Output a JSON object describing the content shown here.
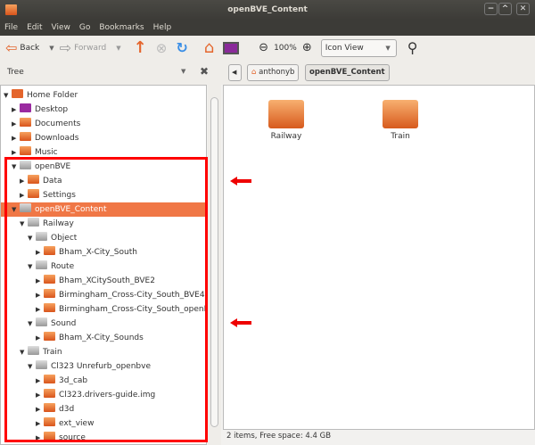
{
  "window": {
    "title": "openBVE_Content"
  },
  "menu": [
    "File",
    "Edit",
    "View",
    "Go",
    "Bookmarks",
    "Help"
  ],
  "toolbar": {
    "back": "Back",
    "forward": "Forward",
    "zoom": "100%",
    "view_mode": "Icon View"
  },
  "sidebar": {
    "label": "Tree"
  },
  "breadcrumb": [
    "anthonyb",
    "openBVE_Content"
  ],
  "tree": [
    {
      "label": "Home Folder",
      "level": 0,
      "expanded": true,
      "icon": "home"
    },
    {
      "label": "Desktop",
      "level": 1,
      "expanded": false,
      "icon": "desktop"
    },
    {
      "label": "Documents",
      "level": 1,
      "expanded": false,
      "icon": "documents"
    },
    {
      "label": "Downloads",
      "level": 1,
      "expanded": false,
      "icon": "downloads"
    },
    {
      "label": "Music",
      "level": 1,
      "expanded": false,
      "icon": "music"
    },
    {
      "label": "openBVE",
      "level": 1,
      "expanded": true,
      "icon": "grey"
    },
    {
      "label": "Data",
      "level": 2,
      "expanded": false,
      "icon": "orange"
    },
    {
      "label": "Settings",
      "level": 2,
      "expanded": false,
      "icon": "orange"
    },
    {
      "label": "openBVE_Content",
      "level": 1,
      "expanded": true,
      "icon": "grey",
      "selected": true
    },
    {
      "label": "Railway",
      "level": 2,
      "expanded": true,
      "icon": "grey"
    },
    {
      "label": "Object",
      "level": 3,
      "expanded": true,
      "icon": "grey"
    },
    {
      "label": "Bham_X-City_South",
      "level": 4,
      "expanded": false,
      "icon": "orange"
    },
    {
      "label": "Route",
      "level": 3,
      "expanded": true,
      "icon": "grey"
    },
    {
      "label": "Bham_XCitySouth_BVE2",
      "level": 4,
      "expanded": false,
      "icon": "orange"
    },
    {
      "label": "Birmingham_Cross-City_South_BVE4",
      "level": 4,
      "expanded": false,
      "icon": "orange"
    },
    {
      "label": "Birmingham_Cross-City_South_openBVE",
      "level": 4,
      "expanded": false,
      "icon": "orange"
    },
    {
      "label": "Sound",
      "level": 3,
      "expanded": true,
      "icon": "grey"
    },
    {
      "label": "Bham_X-City_Sounds",
      "level": 4,
      "expanded": false,
      "icon": "orange"
    },
    {
      "label": "Train",
      "level": 2,
      "expanded": true,
      "icon": "grey"
    },
    {
      "label": "Cl323 Unrefurb_openbve",
      "level": 3,
      "expanded": true,
      "icon": "grey"
    },
    {
      "label": "3d_cab",
      "level": 4,
      "expanded": false,
      "icon": "orange"
    },
    {
      "label": "Cl323.drivers-guide.img",
      "level": 4,
      "expanded": false,
      "icon": "orange"
    },
    {
      "label": "d3d",
      "level": 4,
      "expanded": false,
      "icon": "orange"
    },
    {
      "label": "ext_view",
      "level": 4,
      "expanded": false,
      "icon": "orange"
    },
    {
      "label": "source",
      "level": 4,
      "expanded": false,
      "icon": "orange"
    }
  ],
  "items": [
    "Railway",
    "Train"
  ],
  "status": "2 items, Free space: 4.4 GB",
  "colors": {
    "selection": "#f07746",
    "highlight_box": "#ff0000",
    "accent": "#e4652c"
  }
}
